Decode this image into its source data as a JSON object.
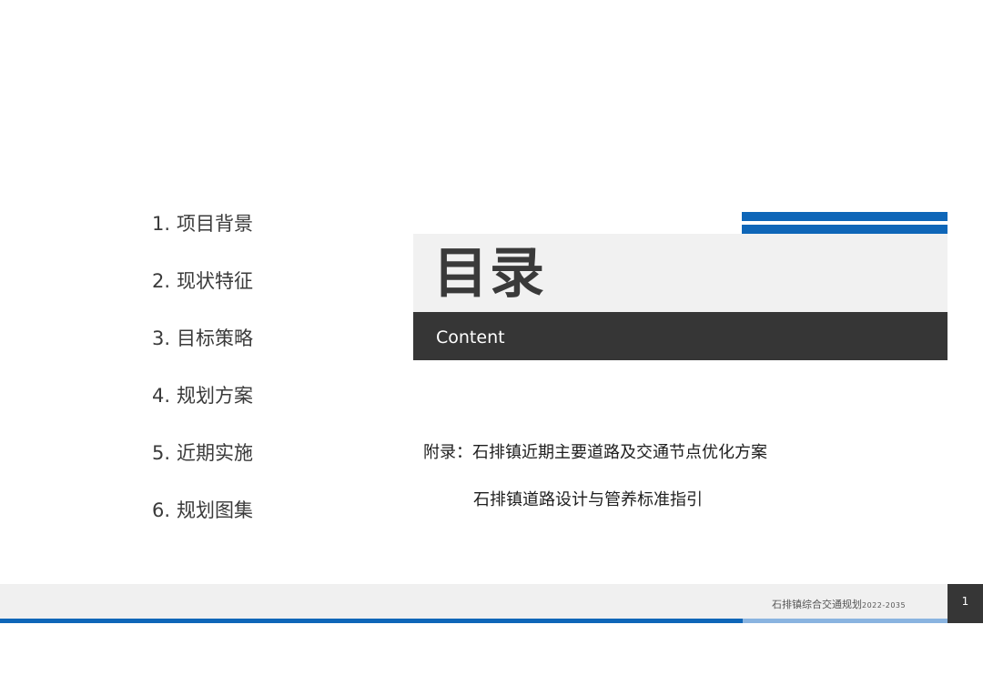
{
  "toc": {
    "items": [
      {
        "num": "1.",
        "label": "项目背景"
      },
      {
        "num": "2.",
        "label": "现状特征"
      },
      {
        "num": "3.",
        "label": "目标策略"
      },
      {
        "num": "4.",
        "label": "规划方案"
      },
      {
        "num": "5.",
        "label": "近期实施"
      },
      {
        "num": "6.",
        "label": "规划图集"
      }
    ]
  },
  "header": {
    "title": "目录",
    "subtitle": "Content"
  },
  "appendix": {
    "line1": "附录：石排镇近期主要道路及交通节点优化方案",
    "line2": "石排镇道路设计与管养标准指引"
  },
  "footer": {
    "doc_title": "石排镇综合交通规划",
    "years": "2022-2035",
    "page_number": "1"
  },
  "colors": {
    "accent_blue": "#0e66b8",
    "dark_bar": "#363636",
    "light_panel": "#f1f1f1"
  }
}
